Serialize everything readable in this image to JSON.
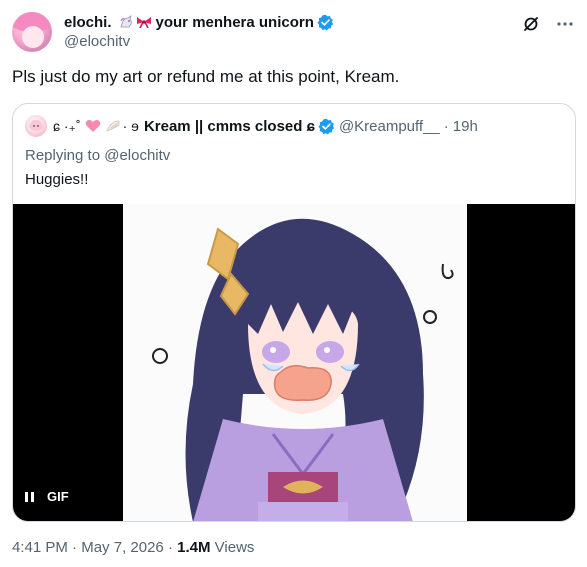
{
  "author": {
    "display_name": "elochi.",
    "name_suffix": "your menhera unicorn",
    "handle": "@elochitv",
    "verified": true,
    "emoji": [
      "unicorn-icon",
      "ribbon-icon"
    ]
  },
  "actions": {
    "grok_icon": "grok-icon",
    "more_icon": "more-icon"
  },
  "tweet": {
    "text": "Pls just do my art or refund me at this point, Kream."
  },
  "quote": {
    "name_deco": "ɕ ·₊˚",
    "name_prefix": "· ɘ",
    "display_name": "Kream || cmms closed ɕ",
    "handle": "@Kreampuff__",
    "separator": "·",
    "time": "19h",
    "replying_to": "Replying to @elochitv",
    "text": "Huggies!!",
    "media": {
      "type": "GIF",
      "badge": "GIF",
      "paused": false
    }
  },
  "meta": {
    "time": "4:41 PM",
    "separator": "·",
    "date": "May 7, 2026",
    "separator2": "·",
    "views_count": "1.4M",
    "views_label": "Views"
  },
  "colors": {
    "verified_blue": "#1d9bf0",
    "secondary_text": "#536471",
    "border": "#cfd9de"
  }
}
